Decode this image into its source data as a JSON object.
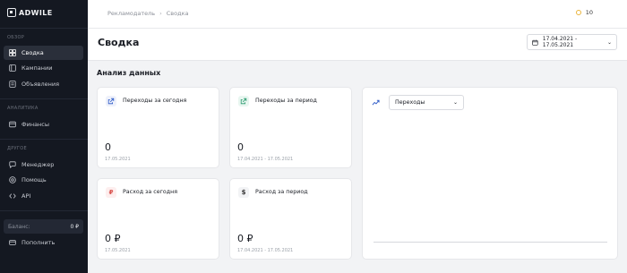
{
  "app": {
    "logo_text": "ADWILE"
  },
  "sidebar": {
    "sections": [
      {
        "title": "ОБЗОР",
        "items": [
          {
            "label": "Сводка",
            "icon": "dashboard-icon",
            "active": true
          },
          {
            "label": "Кампании",
            "icon": "campaigns-icon"
          },
          {
            "label": "Объявления",
            "icon": "ads-icon"
          }
        ]
      },
      {
        "title": "АНАЛИТИКА",
        "items": [
          {
            "label": "Финансы",
            "icon": "wallet-icon"
          }
        ]
      },
      {
        "title": "ДРУГОЕ",
        "items": [
          {
            "label": "Менеджер",
            "icon": "chat-icon"
          },
          {
            "label": "Помощь",
            "icon": "help-icon"
          },
          {
            "label": "API",
            "icon": "code-icon"
          }
        ]
      }
    ],
    "balance": {
      "label": "Баланс:",
      "value": "0 ₽"
    },
    "topup": {
      "label": "Пополнить",
      "icon": "card-icon"
    }
  },
  "topbar": {
    "breadcrumbs": [
      "Рекламодатель",
      "Сводка"
    ],
    "separator": "›",
    "coins": "10"
  },
  "header": {
    "title": "Сводка",
    "date_range": "17.04.2021 - 17.05.2021"
  },
  "content": {
    "section_title": "Анализ данных",
    "cards": [
      {
        "label": "Переходы за сегодня",
        "value": "0",
        "date": "17.05.2021",
        "icon": "external-link-icon"
      },
      {
        "label": "Переходы за период",
        "value": "0",
        "date": "17.04.2021 - 17.05.2021",
        "icon": "external-link-icon"
      },
      {
        "label": "Расход за сегодня",
        "value": "0 ₽",
        "date": "17.05.2021",
        "icon": "ruble-icon",
        "icon_glyph": "₽"
      },
      {
        "label": "Расход за период",
        "value": "0 ₽",
        "date": "17.04.2021 - 17.05.2021",
        "icon": "dollar-icon",
        "icon_glyph": "$"
      }
    ],
    "chart": {
      "metric": "Переходы",
      "icon": "trend-icon"
    }
  },
  "colors": {
    "sidebar_bg": "#141821",
    "accent_blue": "#2a58c6",
    "accent_teal": "#2a9a6e",
    "accent_red": "#d9534f",
    "coin": "#e9b43b"
  }
}
